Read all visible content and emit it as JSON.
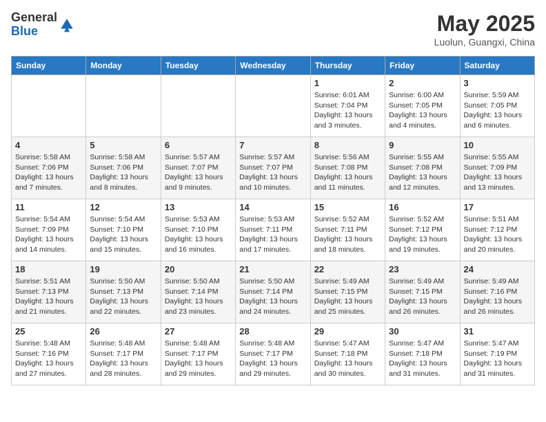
{
  "header": {
    "logo_line1": "General",
    "logo_line2": "Blue",
    "month": "May 2025",
    "location": "Luolun, Guangxi, China"
  },
  "weekdays": [
    "Sunday",
    "Monday",
    "Tuesday",
    "Wednesday",
    "Thursday",
    "Friday",
    "Saturday"
  ],
  "weeks": [
    [
      {
        "day": "",
        "info": ""
      },
      {
        "day": "",
        "info": ""
      },
      {
        "day": "",
        "info": ""
      },
      {
        "day": "",
        "info": ""
      },
      {
        "day": "1",
        "info": "Sunrise: 6:01 AM\nSunset: 7:04 PM\nDaylight: 13 hours\nand 3 minutes."
      },
      {
        "day": "2",
        "info": "Sunrise: 6:00 AM\nSunset: 7:05 PM\nDaylight: 13 hours\nand 4 minutes."
      },
      {
        "day": "3",
        "info": "Sunrise: 5:59 AM\nSunset: 7:05 PM\nDaylight: 13 hours\nand 6 minutes."
      }
    ],
    [
      {
        "day": "4",
        "info": "Sunrise: 5:58 AM\nSunset: 7:06 PM\nDaylight: 13 hours\nand 7 minutes."
      },
      {
        "day": "5",
        "info": "Sunrise: 5:58 AM\nSunset: 7:06 PM\nDaylight: 13 hours\nand 8 minutes."
      },
      {
        "day": "6",
        "info": "Sunrise: 5:57 AM\nSunset: 7:07 PM\nDaylight: 13 hours\nand 9 minutes."
      },
      {
        "day": "7",
        "info": "Sunrise: 5:57 AM\nSunset: 7:07 PM\nDaylight: 13 hours\nand 10 minutes."
      },
      {
        "day": "8",
        "info": "Sunrise: 5:56 AM\nSunset: 7:08 PM\nDaylight: 13 hours\nand 11 minutes."
      },
      {
        "day": "9",
        "info": "Sunrise: 5:55 AM\nSunset: 7:08 PM\nDaylight: 13 hours\nand 12 minutes."
      },
      {
        "day": "10",
        "info": "Sunrise: 5:55 AM\nSunset: 7:09 PM\nDaylight: 13 hours\nand 13 minutes."
      }
    ],
    [
      {
        "day": "11",
        "info": "Sunrise: 5:54 AM\nSunset: 7:09 PM\nDaylight: 13 hours\nand 14 minutes."
      },
      {
        "day": "12",
        "info": "Sunrise: 5:54 AM\nSunset: 7:10 PM\nDaylight: 13 hours\nand 15 minutes."
      },
      {
        "day": "13",
        "info": "Sunrise: 5:53 AM\nSunset: 7:10 PM\nDaylight: 13 hours\nand 16 minutes."
      },
      {
        "day": "14",
        "info": "Sunrise: 5:53 AM\nSunset: 7:11 PM\nDaylight: 13 hours\nand 17 minutes."
      },
      {
        "day": "15",
        "info": "Sunrise: 5:52 AM\nSunset: 7:11 PM\nDaylight: 13 hours\nand 18 minutes."
      },
      {
        "day": "16",
        "info": "Sunrise: 5:52 AM\nSunset: 7:12 PM\nDaylight: 13 hours\nand 19 minutes."
      },
      {
        "day": "17",
        "info": "Sunrise: 5:51 AM\nSunset: 7:12 PM\nDaylight: 13 hours\nand 20 minutes."
      }
    ],
    [
      {
        "day": "18",
        "info": "Sunrise: 5:51 AM\nSunset: 7:13 PM\nDaylight: 13 hours\nand 21 minutes."
      },
      {
        "day": "19",
        "info": "Sunrise: 5:50 AM\nSunset: 7:13 PM\nDaylight: 13 hours\nand 22 minutes."
      },
      {
        "day": "20",
        "info": "Sunrise: 5:50 AM\nSunset: 7:14 PM\nDaylight: 13 hours\nand 23 minutes."
      },
      {
        "day": "21",
        "info": "Sunrise: 5:50 AM\nSunset: 7:14 PM\nDaylight: 13 hours\nand 24 minutes."
      },
      {
        "day": "22",
        "info": "Sunrise: 5:49 AM\nSunset: 7:15 PM\nDaylight: 13 hours\nand 25 minutes."
      },
      {
        "day": "23",
        "info": "Sunrise: 5:49 AM\nSunset: 7:15 PM\nDaylight: 13 hours\nand 26 minutes."
      },
      {
        "day": "24",
        "info": "Sunrise: 5:49 AM\nSunset: 7:16 PM\nDaylight: 13 hours\nand 26 minutes."
      }
    ],
    [
      {
        "day": "25",
        "info": "Sunrise: 5:48 AM\nSunset: 7:16 PM\nDaylight: 13 hours\nand 27 minutes."
      },
      {
        "day": "26",
        "info": "Sunrise: 5:48 AM\nSunset: 7:17 PM\nDaylight: 13 hours\nand 28 minutes."
      },
      {
        "day": "27",
        "info": "Sunrise: 5:48 AM\nSunset: 7:17 PM\nDaylight: 13 hours\nand 29 minutes."
      },
      {
        "day": "28",
        "info": "Sunrise: 5:48 AM\nSunset: 7:17 PM\nDaylight: 13 hours\nand 29 minutes."
      },
      {
        "day": "29",
        "info": "Sunrise: 5:47 AM\nSunset: 7:18 PM\nDaylight: 13 hours\nand 30 minutes."
      },
      {
        "day": "30",
        "info": "Sunrise: 5:47 AM\nSunset: 7:18 PM\nDaylight: 13 hours\nand 31 minutes."
      },
      {
        "day": "31",
        "info": "Sunrise: 5:47 AM\nSunset: 7:19 PM\nDaylight: 13 hours\nand 31 minutes."
      }
    ]
  ]
}
